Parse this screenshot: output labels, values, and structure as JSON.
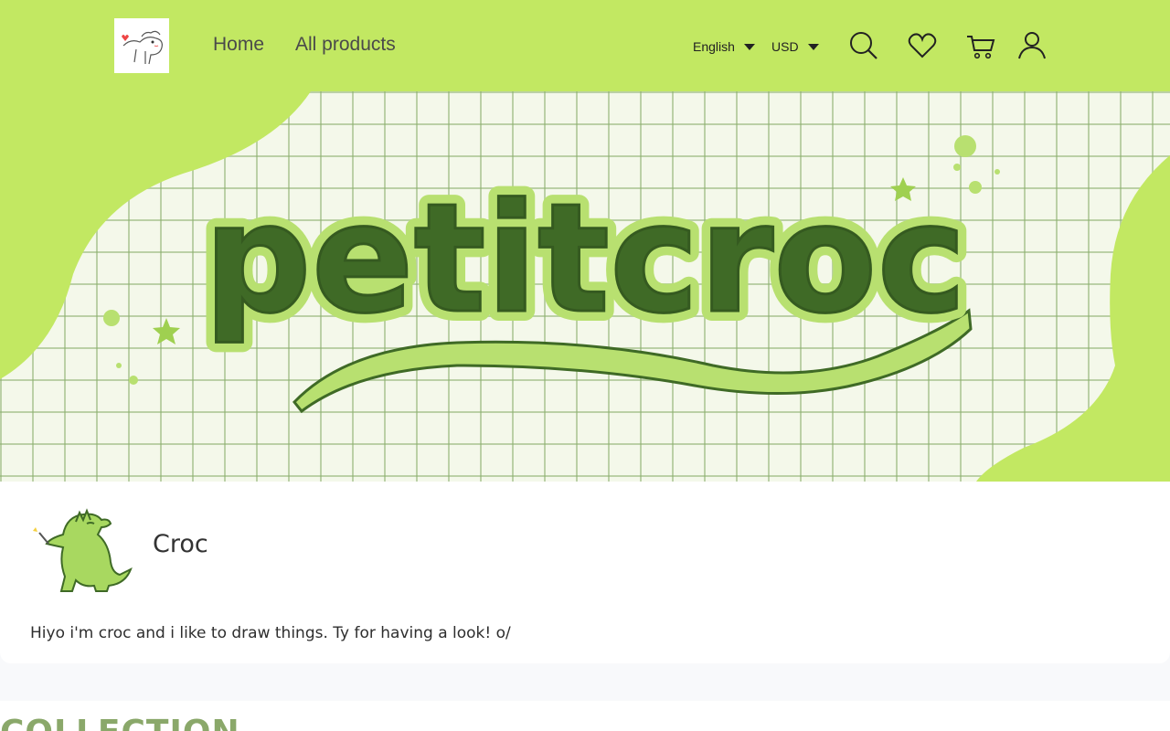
{
  "header": {
    "logo_icon": "croc-sketch-logo",
    "nav": [
      {
        "label": "Home"
      },
      {
        "label": "All products"
      }
    ],
    "language": {
      "selected": "English"
    },
    "currency": {
      "selected": "USD"
    },
    "icons": [
      "search-icon",
      "heart-icon",
      "cart-icon",
      "user-icon"
    ]
  },
  "banner": {
    "logo_text": "petitcroc"
  },
  "profile": {
    "avatar_icon": "croc-mascot-avatar",
    "name": "Croc",
    "bio": "Hiyo i'm croc and i like to draw things. Ty for having a look! o/"
  },
  "collection": {
    "title": "COLLECTION"
  },
  "colors": {
    "header_bg": "#c2e862",
    "accent_dark_green": "#3f6a26",
    "accent_light_green": "#b8e070",
    "collection_title": "#8aa86a"
  }
}
